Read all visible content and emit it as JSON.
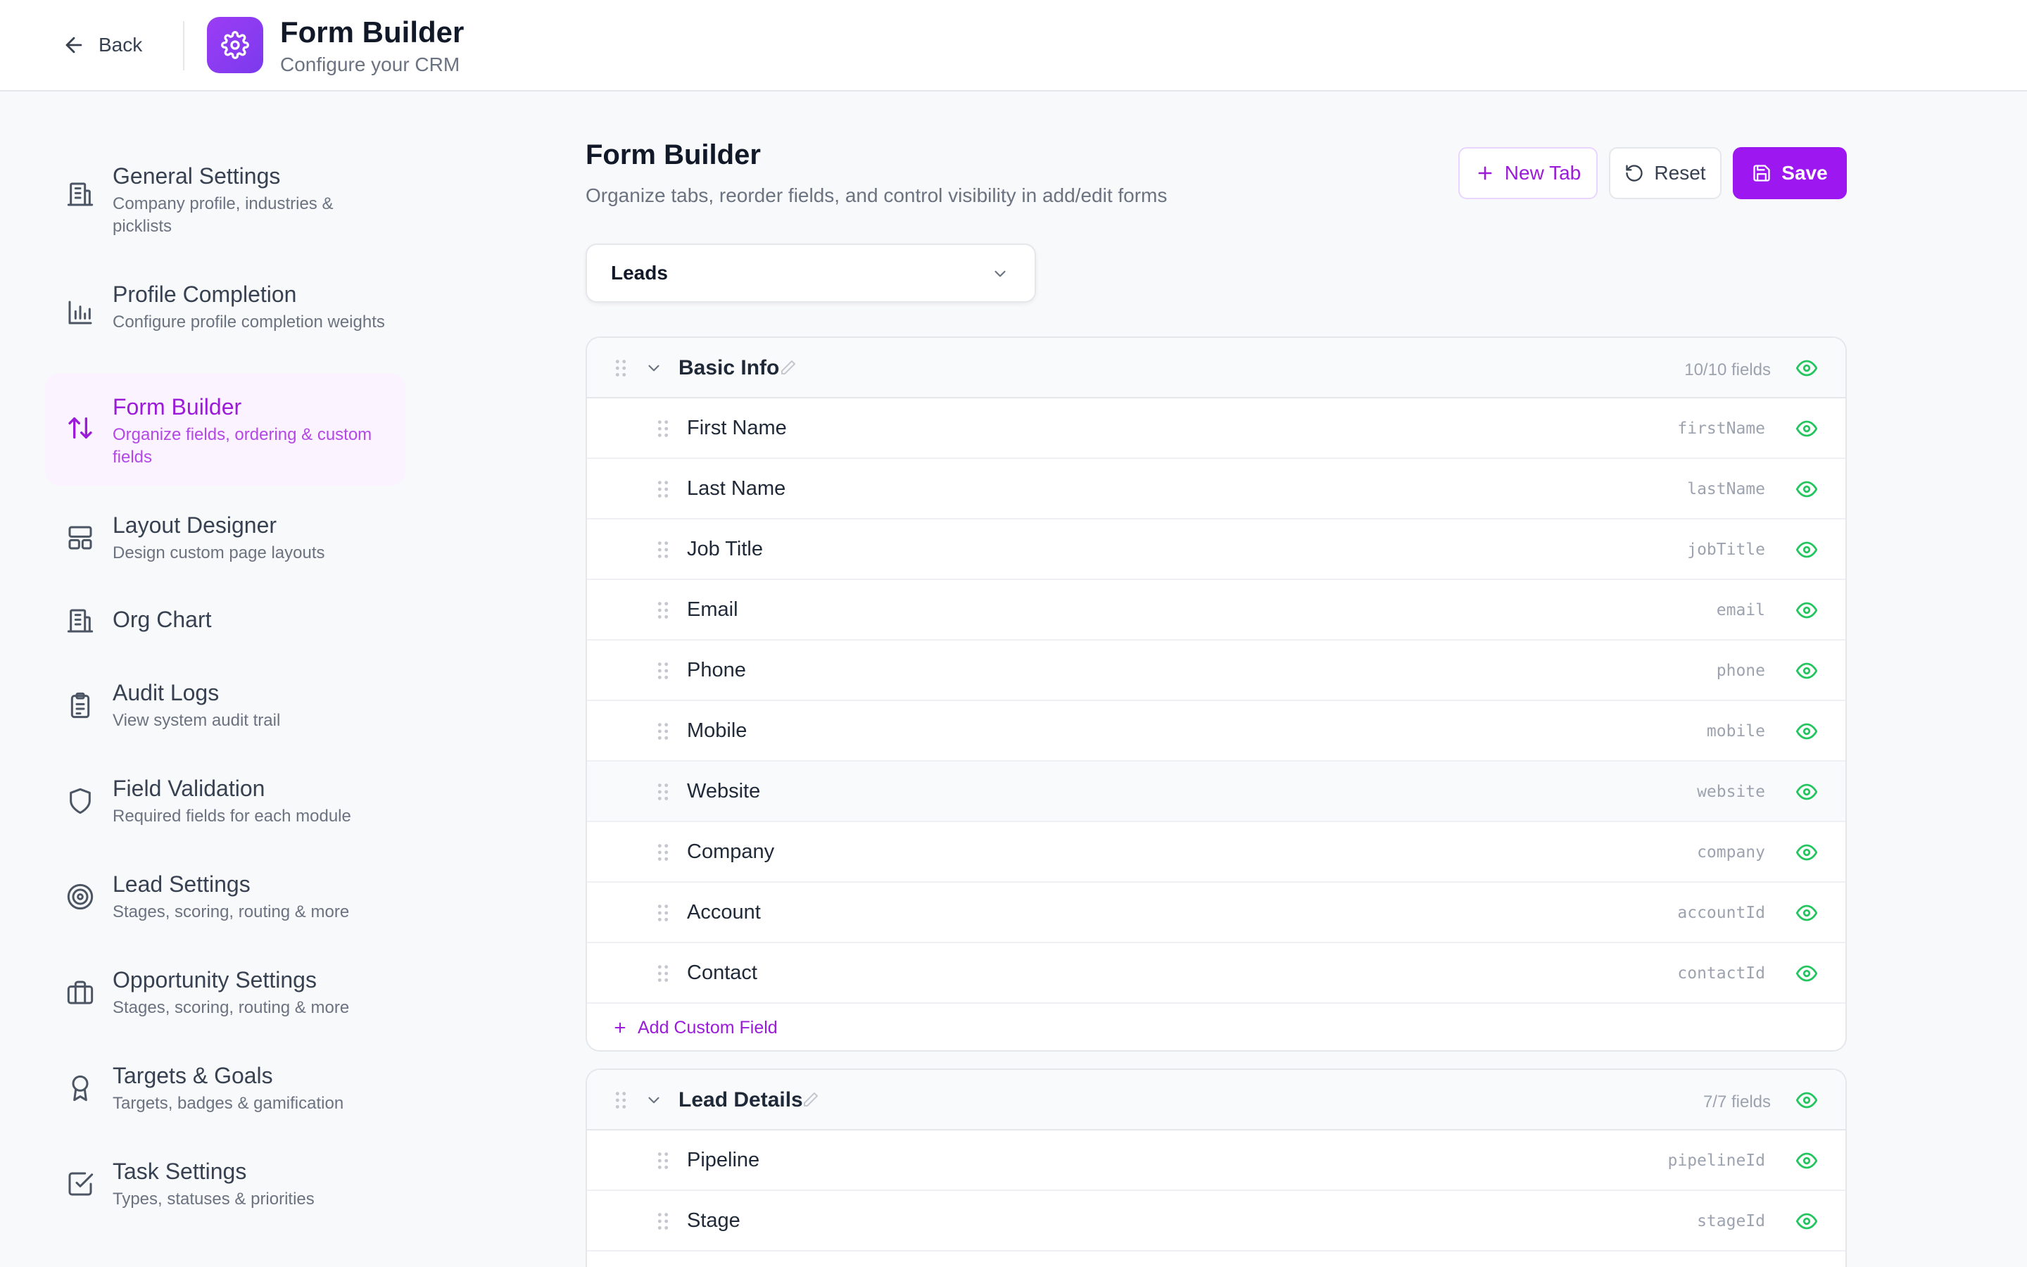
{
  "header": {
    "back_label": "Back",
    "title": "Form Builder",
    "subtitle": "Configure your CRM",
    "logo_icon": "gear-icon"
  },
  "sidebar": {
    "items": [
      {
        "icon": "building-icon",
        "title": "General Settings",
        "desc": "Company profile, industries & picklists",
        "active": false
      },
      {
        "icon": "bar-chart-icon",
        "title": "Profile Completion",
        "desc": "Configure profile completion weights",
        "active": false
      },
      {
        "icon": "sort-arrows-icon",
        "title": "Form Builder",
        "desc": "Organize fields, ordering & custom fields",
        "active": true
      },
      {
        "icon": "layout-icon",
        "title": "Layout Designer",
        "desc": "Design custom page layouts",
        "active": false
      },
      {
        "icon": "building-icon",
        "title": "Org Chart",
        "desc": "",
        "active": false
      },
      {
        "icon": "clipboard-icon",
        "title": "Audit Logs",
        "desc": "View system audit trail",
        "active": false
      },
      {
        "icon": "shield-icon",
        "title": "Field Validation",
        "desc": "Required fields for each module",
        "active": false
      },
      {
        "icon": "target-icon",
        "title": "Lead Settings",
        "desc": "Stages, scoring, routing & more",
        "active": false
      },
      {
        "icon": "briefcase-icon",
        "title": "Opportunity Settings",
        "desc": "Stages, scoring, routing & more",
        "active": false
      },
      {
        "icon": "award-icon",
        "title": "Targets & Goals",
        "desc": "Targets, badges & gamification",
        "active": false
      },
      {
        "icon": "check-square-icon",
        "title": "Task Settings",
        "desc": "Types, statuses & priorities",
        "active": false
      }
    ]
  },
  "main": {
    "title": "Form Builder",
    "subtitle": "Organize tabs, reorder fields, and control visibility in add/edit forms",
    "buttons": {
      "new_tab": "New Tab",
      "reset": "Reset",
      "save": "Save"
    },
    "module_select": {
      "value": "Leads"
    },
    "sections": [
      {
        "name": "Basic Info",
        "count": "10/10 fields",
        "add_label": "Add Custom Field",
        "fields": [
          {
            "label": "First Name",
            "key": "firstName"
          },
          {
            "label": "Last Name",
            "key": "lastName"
          },
          {
            "label": "Job Title",
            "key": "jobTitle"
          },
          {
            "label": "Email",
            "key": "email"
          },
          {
            "label": "Phone",
            "key": "phone"
          },
          {
            "label": "Mobile",
            "key": "mobile"
          },
          {
            "label": "Website",
            "key": "website"
          },
          {
            "label": "Company",
            "key": "company"
          },
          {
            "label": "Account",
            "key": "accountId"
          },
          {
            "label": "Contact",
            "key": "contactId"
          }
        ]
      },
      {
        "name": "Lead Details",
        "count": "7/7 fields",
        "fields": [
          {
            "label": "Pipeline",
            "key": "pipelineId"
          },
          {
            "label": "Stage",
            "key": "stageId"
          }
        ]
      }
    ]
  },
  "colors": {
    "accent": "#9d17f0",
    "visible_green": "#22c55e",
    "active_bg": "#fbf3ff"
  }
}
